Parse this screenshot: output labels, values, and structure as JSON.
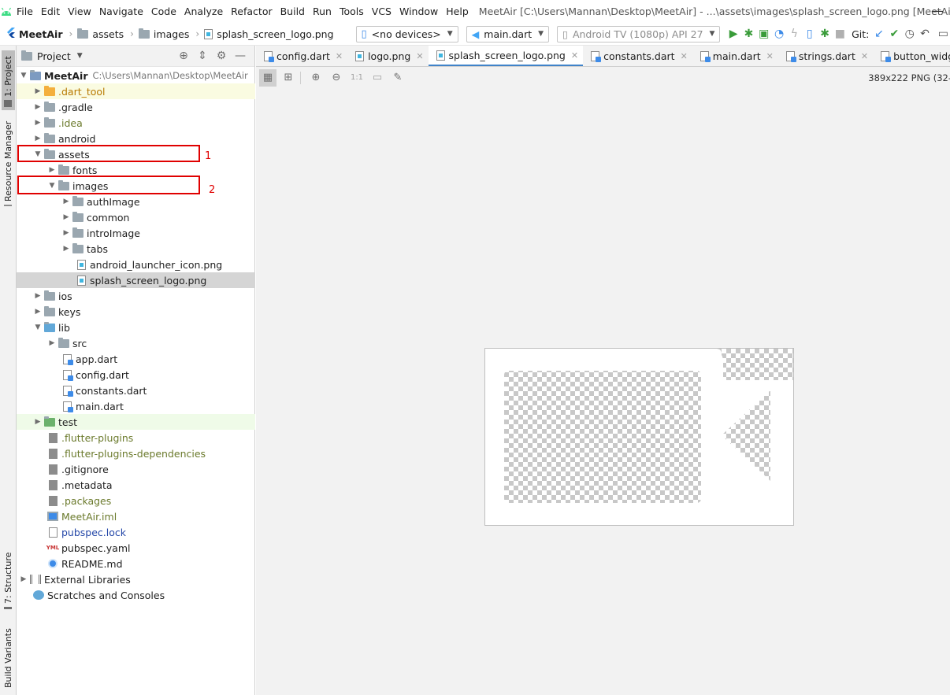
{
  "menubar": {
    "items": [
      "File",
      "Edit",
      "View",
      "Navigate",
      "Code",
      "Analyze",
      "Refactor",
      "Build",
      "Run",
      "Tools",
      "VCS",
      "Window",
      "Help"
    ],
    "window_title": "MeetAir [C:\\Users\\Mannan\\Desktop\\MeetAir] - ...\\assets\\images\\splash_screen_logo.png [MeetAir]"
  },
  "toolbar": {
    "breadcrumbs": [
      "MeetAir",
      "images",
      "images",
      "splash_screen_logo.png"
    ],
    "breadcrumb_root": "MeetAir",
    "breadcrumb_assets": "assets",
    "breadcrumb_images": "images",
    "breadcrumb_file": "splash_screen_logo.png",
    "device_combo": "<no devices>",
    "run_config": "main.dart",
    "emulator": "Android TV (1080p) API 27",
    "git_label": "Git:"
  },
  "left_strip": {
    "project_tab": "1: Project",
    "resource_manager_tab": "Resource Manager",
    "structure_tab": "7: Structure",
    "build_variants_tab": "Build Variants"
  },
  "project_panel": {
    "title": "Project",
    "root_name": "MeetAir",
    "root_path": "C:\\Users\\Mannan\\Desktop\\MeetAir",
    "tree": {
      "dart_tool": ".dart_tool",
      "gradle": ".gradle",
      "idea": ".idea",
      "android": "android",
      "assets": "assets",
      "fonts": "fonts",
      "images": "images",
      "authImage": "authImage",
      "common": "common",
      "introImage": "introImage",
      "tabs": "tabs",
      "android_launcher_icon": "android_launcher_icon.png",
      "splash_screen_logo": "splash_screen_logo.png",
      "ios": "ios",
      "keys": "keys",
      "lib": "lib",
      "src": "src",
      "app_dart": "app.dart",
      "config_dart": "config.dart",
      "constants_dart": "constants.dart",
      "main_dart": "main.dart",
      "test": "test",
      "flutter_plugins": ".flutter-plugins",
      "flutter_plugins_dependencies": ".flutter-plugins-dependencies",
      "gitignore": ".gitignore",
      "metadata": ".metadata",
      "packages": ".packages",
      "meetair_iml": "MeetAir.iml",
      "pubspec_lock": "pubspec.lock",
      "pubspec_yaml": "pubspec.yaml",
      "readme": "README.md",
      "external_libraries": "External Libraries",
      "scratches": "Scratches and Consoles"
    },
    "annotations": [
      "1",
      "2"
    ]
  },
  "editor": {
    "tabs": [
      "config.dart",
      "logo.png",
      "splash_screen_logo.png",
      "constants.dart",
      "main.dart",
      "strings.dart",
      "button_widget.dart"
    ],
    "active_tab": "splash_screen_logo.png",
    "image_info": "389x222 PNG (32-",
    "zoom_actual": "1:1"
  },
  "colors": {
    "accent": "#4083c9",
    "annotation_red": "#e00000",
    "selection": "#d5d5d5",
    "folder": "#9aa7b0",
    "excluded_folder": "#f4af3d",
    "run_green": "#3a9c3a"
  }
}
